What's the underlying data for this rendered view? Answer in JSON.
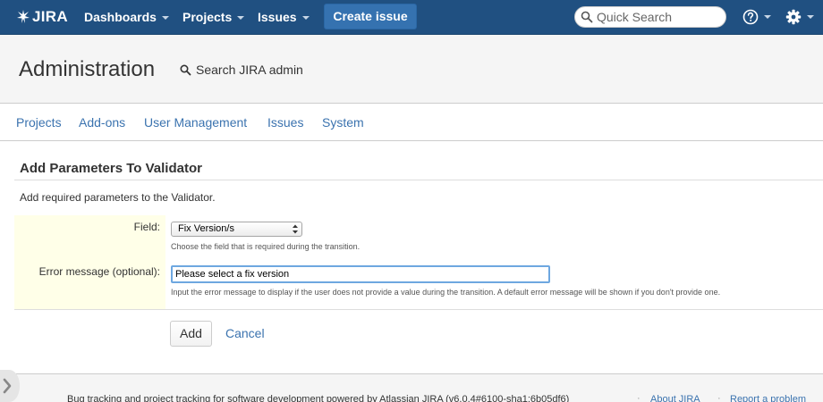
{
  "header": {
    "logo_text": "JIRA",
    "nav": [
      {
        "label": "Dashboards"
      },
      {
        "label": "Projects"
      },
      {
        "label": "Issues"
      }
    ],
    "create_label": "Create issue",
    "search_placeholder": "Quick Search"
  },
  "admin": {
    "title": "Administration",
    "search_label": "Search JIRA admin",
    "tabs": [
      "Projects",
      "Add-ons",
      "User Management",
      "Issues",
      "System"
    ]
  },
  "content": {
    "title": "Add Parameters To Validator",
    "description": "Add required parameters to the Validator.",
    "field": {
      "label": "Field:",
      "selected": "Fix Version/s",
      "hint": "Choose the field that is required during the transition."
    },
    "error_message": {
      "label": "Error message (optional):",
      "value": "Please select a fix version",
      "hint": "Input the error message to display if the user does not provide a value during the transition. A default error message will be shown if you don't provide one."
    },
    "add_label": "Add",
    "cancel_label": "Cancel"
  },
  "footer": {
    "text": "Bug tracking and project tracking for software development powered by Atlassian JIRA (v6.0.4#6100-sha1:6b05df6)",
    "about": "About JIRA",
    "report": "Report a problem"
  },
  "colors": {
    "topbar": "#205081",
    "create_button": "#3572b0",
    "link": "#3b73af",
    "label_background": "#ffffe8"
  }
}
